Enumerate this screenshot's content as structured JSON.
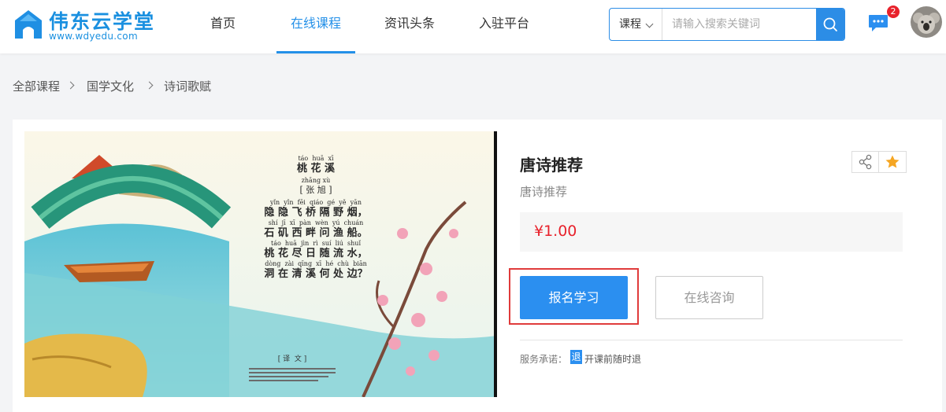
{
  "brand": {
    "title": "伟东云学堂",
    "url": "www.wdyedu.com"
  },
  "nav": [
    {
      "label": "首页"
    },
    {
      "label": "在线课程",
      "active": true
    },
    {
      "label": "资讯头条"
    },
    {
      "label": "入驻平台"
    }
  ],
  "search": {
    "type": "课程",
    "placeholder": "请输入搜索关键词"
  },
  "messages": {
    "count": "2"
  },
  "breadcrumb": [
    "全部课程",
    "国学文化",
    "诗词歌赋"
  ],
  "course": {
    "title": "唐诗推荐",
    "subtitle": "唐诗推荐",
    "price": "¥1.00",
    "enroll_label": "报名学习",
    "consult_label": "在线咨询",
    "promise_label": "服务承诺：",
    "promise_tag": "退",
    "promise_text": "开课前随时退"
  },
  "poem": {
    "title_pinyin": "táo  huā  xī",
    "title": "桃 花 溪",
    "author_pinyin": "zhāng xù",
    "author": "[ 张 旭 ]",
    "lines": [
      {
        "pinyin": "yǐn  yǐn  fēi  qiáo  gé  yě  yān",
        "text": "隐 隐 飞 桥 隔 野 烟，"
      },
      {
        "pinyin": "shí  jī  xī  pàn  wèn  yú  chuán",
        "text": "石 矶 西 畔 问 渔 船。"
      },
      {
        "pinyin": "táo  huā  jìn  rì  suí  liú  shuǐ",
        "text": "桃 花 尽 日 随 流 水，"
      },
      {
        "pinyin": "dòng  zài  qīng  xī  hé  chù  biān",
        "text": "洞 在 清 溪 何 处 边？"
      }
    ],
    "translation_heading": "[ 译  文 ]"
  },
  "colors": {
    "accent": "#2b8ff0",
    "price": "#e8222c",
    "highlight": "#e03b3b",
    "fav_star": "#f5a623"
  }
}
